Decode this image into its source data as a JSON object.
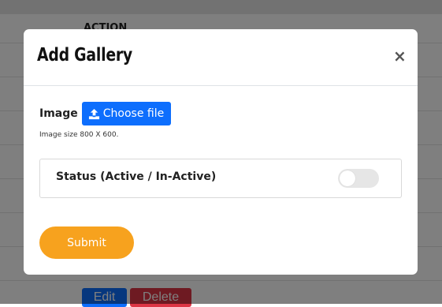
{
  "background": {
    "table_header_label": "ACTION",
    "edit_label": "Edit",
    "delete_label": "Delete"
  },
  "modal": {
    "title": "Add Gallery",
    "close_glyph": "×",
    "image_label": "Image",
    "choose_file_label": "Choose file",
    "image_hint": "Image size 800 X 600.",
    "status_label": "Status (Active / In-Active)",
    "status_active": false,
    "submit_label": "Submit"
  },
  "icons": {
    "upload": "upload-icon",
    "close": "close-icon"
  },
  "colors": {
    "primary": "#0d6efd",
    "danger": "#dc3545",
    "submit": "#f7a21e",
    "toggle_off": "#e6e6e6"
  }
}
